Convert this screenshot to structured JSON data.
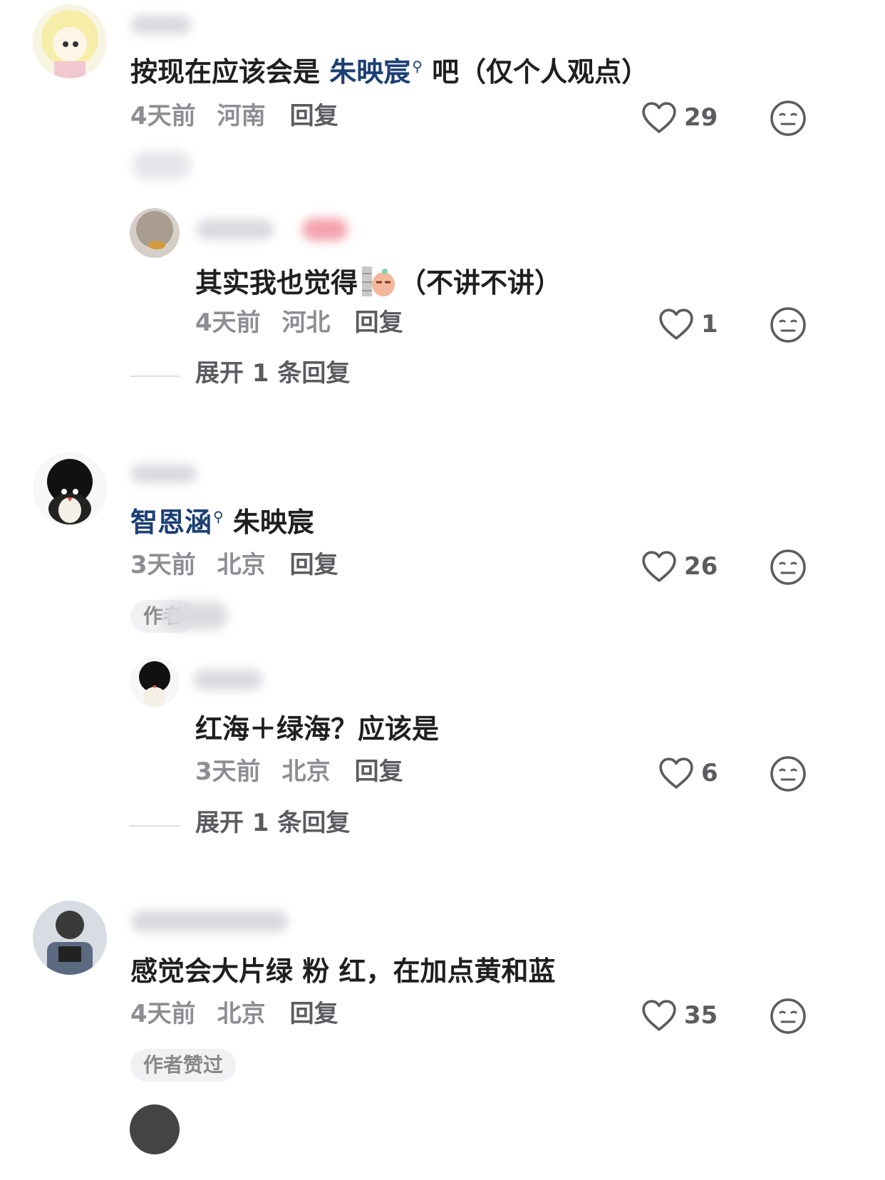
{
  "comments": [
    {
      "text_before": "按现在应该会是 ",
      "mention": "朱映宸",
      "text_after": " 吧（仅个人观点）",
      "time": "4天前",
      "location": "河南",
      "reply_label": "回复",
      "likes": "29",
      "reply": {
        "text": "其实我也觉得",
        "text_after": "（不讲不讲）",
        "time": "4天前",
        "location": "河北",
        "reply_label": "回复",
        "likes": "1"
      },
      "expand_label": "展开 1 条回复"
    },
    {
      "mention": "智恩涵",
      "text_after": " 朱映宸",
      "time": "3天前",
      "location": "北京",
      "reply_label": "回复",
      "likes": "26",
      "badge": "作者",
      "reply": {
        "text": "红海＋绿海？应该是",
        "time": "3天前",
        "location": "北京",
        "reply_label": "回复",
        "likes": "6"
      },
      "expand_label": "展开 1 条回复"
    },
    {
      "text": "感觉会大片绿 粉 红，在加点黄和蓝",
      "time": "4天前",
      "location": "北京",
      "reply_label": "回复",
      "likes": "35",
      "badge": "作者赞过"
    }
  ],
  "icons": {
    "like": "heart-outline-icon",
    "react": "neutral-face-icon",
    "search": "search-icon"
  },
  "colors": {
    "link": "#1c3f74",
    "meta": "#8d8d93",
    "text": "#1f1f1f"
  }
}
